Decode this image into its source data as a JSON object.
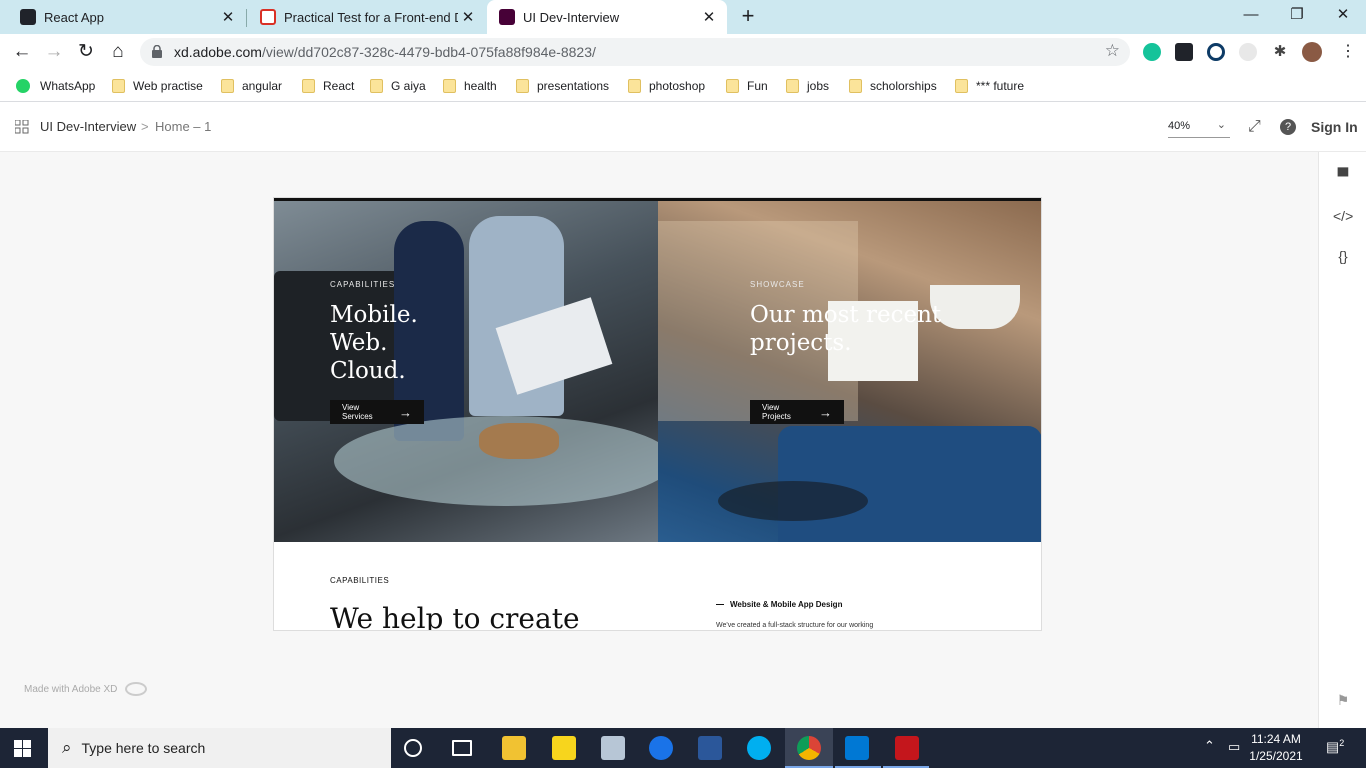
{
  "browser": {
    "tabs": [
      {
        "title": "React App",
        "favicon": "react-favicon"
      },
      {
        "title": "Practical Test for a Front-end Dev",
        "favicon": "gmail-favicon"
      },
      {
        "title": "UI Dev-Interview",
        "favicon": "adobe-xd-favicon",
        "active": true
      }
    ],
    "url_host": "xd.adobe.com",
    "url_path": "/view/dd702c87-328c-4479-bdb4-075fa88f984e-8823/",
    "bookmarks": [
      "WhatsApp",
      "Web practise",
      "angular",
      "React",
      "G aiya",
      "health",
      "presentations",
      "photoshop",
      "Fun",
      "jobs",
      "scholorships",
      "*** future"
    ]
  },
  "xd": {
    "project": "UI Dev-Interview",
    "separator": ">",
    "artboard_name": "Home – 1",
    "zoom": "40%",
    "sign_in": "Sign In",
    "made_with": "Made with Adobe XD"
  },
  "design": {
    "left": {
      "eyebrow": "CAPABILITIES",
      "headline": [
        "Mobile.",
        "Web.",
        "Cloud."
      ],
      "cta": "View Services"
    },
    "right": {
      "eyebrow": "SHOWCASE",
      "headline": [
        "Our most recent",
        "projects."
      ],
      "cta": "View Projects"
    },
    "section": {
      "eyebrow": "CAPABILITIES",
      "heading": "We help to create",
      "service": "Website & Mobile App Design",
      "service_desc": "We've created a full-stack structure for our working"
    }
  },
  "taskbar": {
    "search_placeholder": "Type here to search",
    "time": "11:24 AM",
    "date": "1/25/2021",
    "notifications": "2"
  },
  "colors": {
    "tabstrip": "#cde8f0",
    "taskbar": "#1d2536",
    "canvas": "#f7f7f7",
    "cta_bg": "#111111"
  }
}
